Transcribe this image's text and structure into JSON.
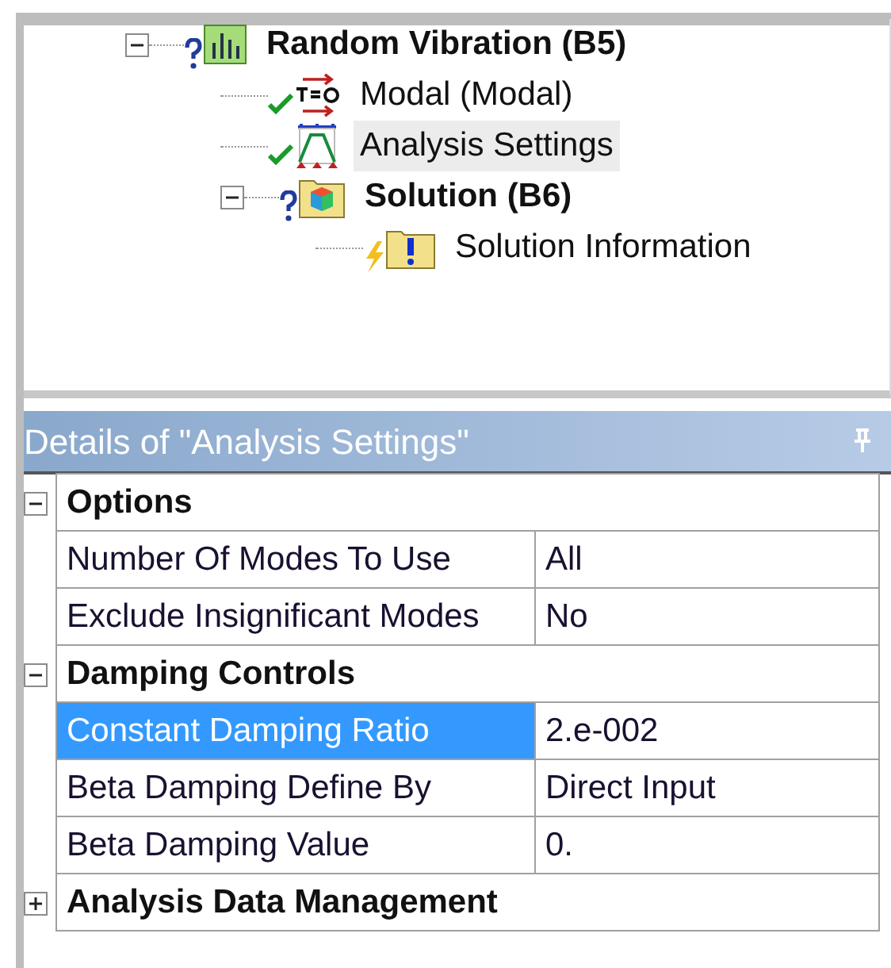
{
  "tree": [
    {
      "label": "Random Vibration (B5)",
      "bold": true,
      "kind": "chart",
      "solved": false,
      "pending": false,
      "selected": false,
      "expanded": true,
      "children": [
        {
          "label": "Modal (Modal)",
          "bold": false,
          "kind": "modal",
          "solved": true,
          "pending": false,
          "selected": false
        },
        {
          "label": "Analysis Settings",
          "bold": false,
          "kind": "settings",
          "solved": true,
          "pending": false,
          "selected": true
        },
        {
          "label": "Solution (B6)",
          "bold": true,
          "kind": "solution",
          "solved": false,
          "pending": false,
          "selected": false,
          "expanded": true,
          "children": [
            {
              "label": "Solution Information",
              "bold": false,
              "kind": "info",
              "solved": false,
              "pending": true,
              "selected": false
            }
          ]
        }
      ]
    }
  ],
  "details": {
    "title": "Details of \"Analysis Settings\"",
    "rows": [
      {
        "kind": "group",
        "label": "Options",
        "expanded": true
      },
      {
        "kind": "property",
        "label": "Number Of Modes To Use",
        "value": "All",
        "selected": false
      },
      {
        "kind": "property",
        "label": "Exclude Insignificant Modes",
        "value": "No",
        "selected": false
      },
      {
        "kind": "group",
        "label": "Damping Controls",
        "expanded": true
      },
      {
        "kind": "property",
        "label": "Constant Damping Ratio",
        "value": "2.e-002",
        "selected": true
      },
      {
        "kind": "property",
        "label": "Beta Damping Define By",
        "value": "Direct Input",
        "selected": false
      },
      {
        "kind": "property",
        "label": "Beta Damping Value",
        "value": "0.",
        "selected": false
      },
      {
        "kind": "group",
        "label": "Analysis Data Management",
        "expanded": false
      }
    ]
  }
}
